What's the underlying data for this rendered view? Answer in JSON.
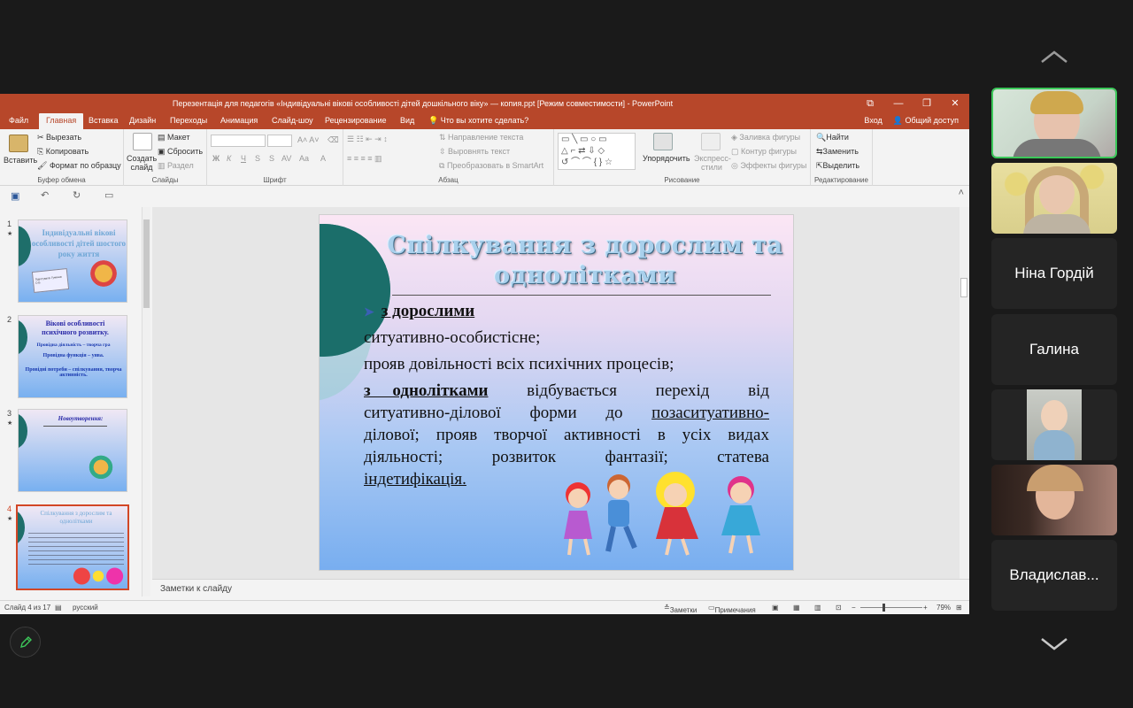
{
  "window": {
    "title": "Перезентація для педагогів «Індивідуальні вікові особливості дітей дошкільного віку» — копия.ppt [Режим совместимости] - PowerPoint",
    "controls": [
      "⧉",
      "—",
      "❐",
      "✕"
    ]
  },
  "menu": {
    "tabs": [
      "Файл",
      "Главная",
      "Вставка",
      "Дизайн",
      "Переходы",
      "Анимация",
      "Слайд-шоу",
      "Рецензирование",
      "Вид"
    ],
    "tell_me": "Что вы хотите сделать?",
    "signin": "Вход",
    "share": "Общий доступ"
  },
  "ribbon": {
    "clipboard": {
      "paste": "Вставить",
      "cut": "Вырезать",
      "copy": "Копировать",
      "format_painter": "Формат по образцу",
      "label": "Буфер обмена"
    },
    "slides": {
      "new_slide": "Создать слайд",
      "layout": "Макет",
      "reset": "Сбросить",
      "section": "Раздел",
      "label": "Слайды"
    },
    "font": {
      "bold": "Ж",
      "italic": "К",
      "underline": "Ч",
      "strike": "S",
      "aa": "Aa",
      "label": "Шрифт"
    },
    "paragraph": {
      "text_direction": "Направление текста",
      "align_text": "Выровнять текст",
      "smartart": "Преобразовать в SmartArt",
      "label": "Абзац"
    },
    "drawing": {
      "arrange": "Упорядочить",
      "quick_styles": "Экспресс-стили",
      "fill": "Заливка фигуры",
      "outline": "Контур фигуры",
      "effects": "Эффекты фигуры",
      "label": "Рисование"
    },
    "editing": {
      "find": "Найти",
      "replace": "Заменить",
      "select": "Выделить",
      "label": "Редактирование"
    }
  },
  "thumbnails": [
    {
      "num": "1",
      "title": "Індивідуальні вікові особливості дітей шостого року життя",
      "caption": "Підготувала: Гуменюк О.В."
    },
    {
      "num": "2",
      "title": "Вікові особливості психічного розвитку.",
      "line1": "Провідна діяльність – творча гра",
      "line2": "Провідна функція – уява.",
      "line3": "Провідні потреби – спілкування, творча активність."
    },
    {
      "num": "3",
      "title": "Новоутворення:"
    },
    {
      "num": "4",
      "title": "Спілкування з дорослим та однолітками",
      "selected": true
    }
  ],
  "slide": {
    "title_line1": "Спілкування з дорослим та",
    "title_line2": "однолітками",
    "bullet": "з дорослими",
    "line1": "ситуативно-особистісне;",
    "line2": "прояв довільності всіх психічних процесів;",
    "p3_l1_bold": "з однолітками",
    "p3_l1_words": [
      "відбувається",
      "перехід",
      "від"
    ],
    "p3_l2_words": [
      "ситуативно-ділової",
      "форми",
      "до",
      "позаситуативно-"
    ],
    "p3_l3_words": [
      "ділової;",
      "прояв",
      "творчої",
      "активності",
      "в",
      "усіх",
      "видах"
    ],
    "p3_l4_words": [
      "діяльності;",
      "розвиток",
      "фантазії;",
      "статева"
    ],
    "p3_l5": "індетифікація."
  },
  "notes": {
    "placeholder": "Заметки к слайду"
  },
  "status": {
    "slide_of": "Слайд 4 из 17",
    "lang": "русский",
    "notes": "Заметки",
    "comments": "Примечания",
    "zoom": "79%"
  },
  "participants": [
    {
      "type": "video",
      "name": ""
    },
    {
      "type": "video",
      "name": ""
    },
    {
      "type": "name",
      "name": "Ніна Гордій"
    },
    {
      "type": "name",
      "name": "Галина"
    },
    {
      "type": "video",
      "name": ""
    },
    {
      "type": "video",
      "name": ""
    },
    {
      "type": "name",
      "name": "Владислав..."
    }
  ],
  "colors": {
    "ppt_accent": "#b7472a",
    "active_speaker": "#3cc85a",
    "selection": "#d24726"
  }
}
